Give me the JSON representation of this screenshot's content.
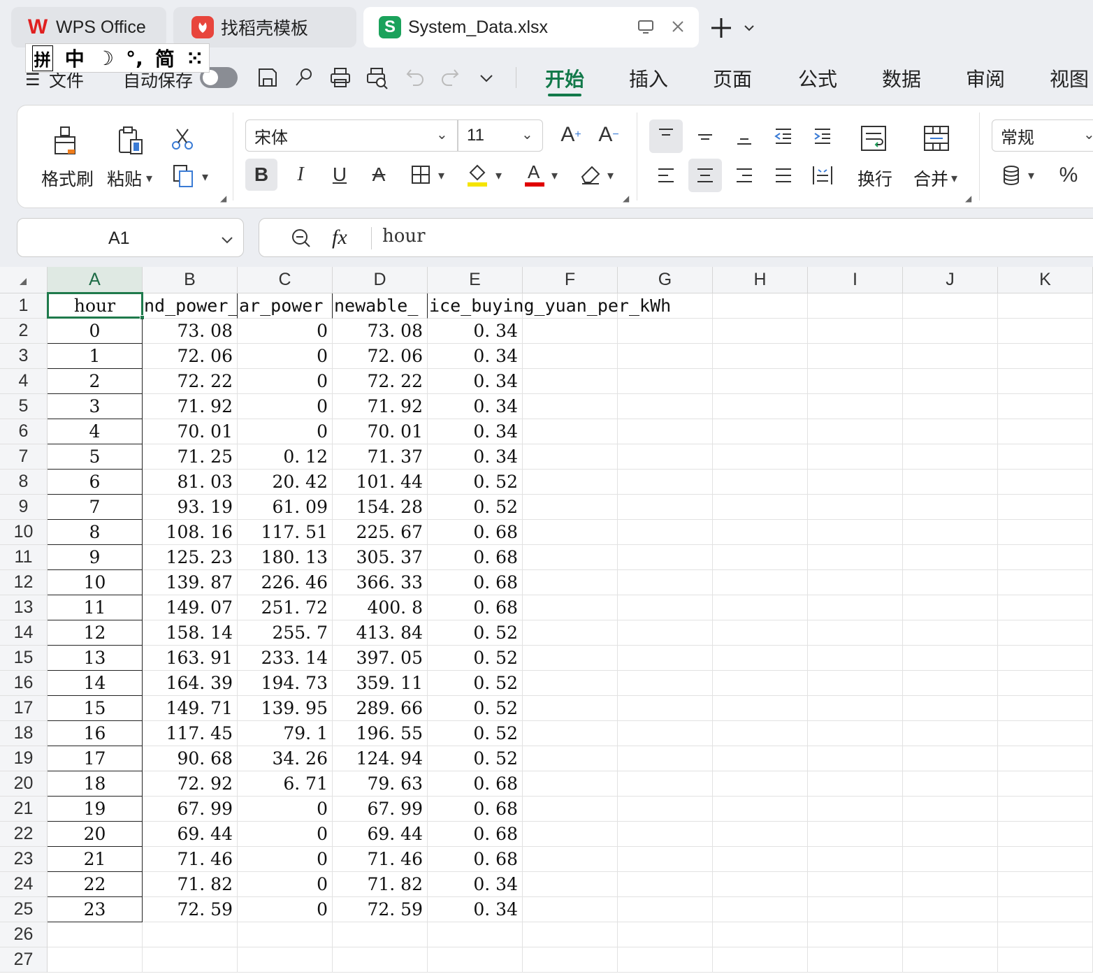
{
  "tabs": [
    {
      "label": "WPS Office",
      "icon": "wps-logo-icon"
    },
    {
      "label": "找稻壳模板",
      "icon": "docer-logo-icon"
    },
    {
      "label": "System_Data.xlsx",
      "icon": "spreadsheet-s-icon",
      "icon_text": "S"
    }
  ],
  "ime": {
    "items": [
      "拼",
      "中",
      "☽",
      "°,",
      "简",
      "⁙"
    ]
  },
  "menu": {
    "file": "文件",
    "autosave": "自动保存",
    "tabs": [
      "开始",
      "插入",
      "页面",
      "公式",
      "数据",
      "审阅",
      "视图"
    ],
    "active_tab": "开始"
  },
  "ribbon": {
    "format_painter": "格式刷",
    "paste": "粘贴",
    "font_name": "宋体",
    "font_size": "11",
    "wrap": "换行",
    "merge": "合并",
    "number_format": "常规",
    "bold": "B",
    "italic": "I",
    "underline": "U",
    "strike": "A",
    "percent": "%",
    "fill_color": "#f5e400",
    "font_color": "#e00000"
  },
  "formula_bar": {
    "cell_ref": "A1",
    "fx": "fx",
    "content": "hour"
  },
  "sheet": {
    "columns": [
      "A",
      "B",
      "C",
      "D",
      "E",
      "F",
      "G",
      "H",
      "I",
      "J",
      "K"
    ],
    "row_numbers": [
      "1",
      "2",
      "3",
      "4",
      "5",
      "6",
      "7",
      "8",
      "9",
      "10",
      "11",
      "12",
      "13",
      "14",
      "15",
      "16",
      "17",
      "18",
      "19",
      "20",
      "21",
      "22",
      "23",
      "24",
      "25",
      "26",
      "27"
    ],
    "header_A": "hour",
    "header_B": "nd_power_",
    "header_C": "ar_power",
    "header_D": "newable_",
    "header_E": "ice_buying_yuan_per_kWh",
    "rows": [
      [
        "0",
        "73. 08",
        "0",
        "73. 08",
        "0. 34"
      ],
      [
        "1",
        "72. 06",
        "0",
        "72. 06",
        "0. 34"
      ],
      [
        "2",
        "72. 22",
        "0",
        "72. 22",
        "0. 34"
      ],
      [
        "3",
        "71. 92",
        "0",
        "71. 92",
        "0. 34"
      ],
      [
        "4",
        "70. 01",
        "0",
        "70. 01",
        "0. 34"
      ],
      [
        "5",
        "71. 25",
        "0. 12",
        "71. 37",
        "0. 34"
      ],
      [
        "6",
        "81. 03",
        "20. 42",
        "101. 44",
        "0. 52"
      ],
      [
        "7",
        "93. 19",
        "61. 09",
        "154. 28",
        "0. 52"
      ],
      [
        "8",
        "108. 16",
        "117. 51",
        "225. 67",
        "0. 68"
      ],
      [
        "9",
        "125. 23",
        "180. 13",
        "305. 37",
        "0. 68"
      ],
      [
        "10",
        "139. 87",
        "226. 46",
        "366. 33",
        "0. 68"
      ],
      [
        "11",
        "149. 07",
        "251. 72",
        "400. 8",
        "0. 68"
      ],
      [
        "12",
        "158. 14",
        "255. 7",
        "413. 84",
        "0. 52"
      ],
      [
        "13",
        "163. 91",
        "233. 14",
        "397. 05",
        "0. 52"
      ],
      [
        "14",
        "164. 39",
        "194. 73",
        "359. 11",
        "0. 52"
      ],
      [
        "15",
        "149. 71",
        "139. 95",
        "289. 66",
        "0. 52"
      ],
      [
        "16",
        "117. 45",
        "79. 1",
        "196. 55",
        "0. 52"
      ],
      [
        "17",
        "90. 68",
        "34. 26",
        "124. 94",
        "0. 52"
      ],
      [
        "18",
        "72. 92",
        "6. 71",
        "79. 63",
        "0. 68"
      ],
      [
        "19",
        "67. 99",
        "0",
        "67. 99",
        "0. 68"
      ],
      [
        "20",
        "69. 44",
        "0",
        "69. 44",
        "0. 68"
      ],
      [
        "21",
        "71. 46",
        "0",
        "71. 46",
        "0. 68"
      ],
      [
        "22",
        "71. 82",
        "0",
        "71. 82",
        "0. 34"
      ],
      [
        "23",
        "72. 59",
        "0",
        "72. 59",
        "0. 34"
      ]
    ]
  }
}
